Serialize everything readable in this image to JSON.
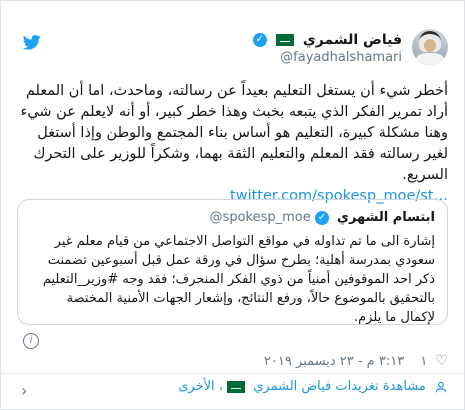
{
  "tweet": {
    "author": {
      "name": "فياض الشمري",
      "handle": "@fayadhalshamari",
      "verified": true,
      "flag": "saudi-flag"
    },
    "text": "أخطر شيء أن يستغل التعليم بعيداً عن رسالته، وماحدث، اما أن المعلم أراد تمرير الفكر الذي يتبعه بخبث وهذا خطر كبير، أو أنه لايعلم عن شيء وهنا مشكلة كبيرة، التعليم هو أساس بناء المجتمع والوطن وإذا أستغل لغير رسالته فقد المعلم والتعليم الثقة بهما، وشكراً للوزير على التحرك السريع.",
    "link": "twitter.com/spokesp_moe/st…",
    "quote": {
      "name": "ابتسام الشهري",
      "handle": "@spokesp_moe",
      "verified": true,
      "text": "إشارة الى ما تم تداوله في مواقع التواصل الاجتماعي من قيام معلم غير سعودي بمدرسة أهلية؛ بطرح سؤال في ورقة عمل قبل أسبوعين تضمنت ذكر احد الموقوفين أمنياً من ذوي الفكر المنحرف؛ فقد وجه #وزير_التعليم بالتحقيق بالموضوع حالاً، ورفع النتائج، وإشعار الجهات الأمنية المختصة لإكمال ما يلزم."
    },
    "likes": "١",
    "timestamp": "٣:١٣ م - ٢٣ ديسمبر ٢٠١٩",
    "footer_label": "مشاهدة تغريدات فياض الشمري",
    "footer_suffix": "، الأخرى",
    "colors": {
      "brand": "#1da1f2",
      "link": "#1b95e0",
      "muted": "#657786"
    }
  }
}
